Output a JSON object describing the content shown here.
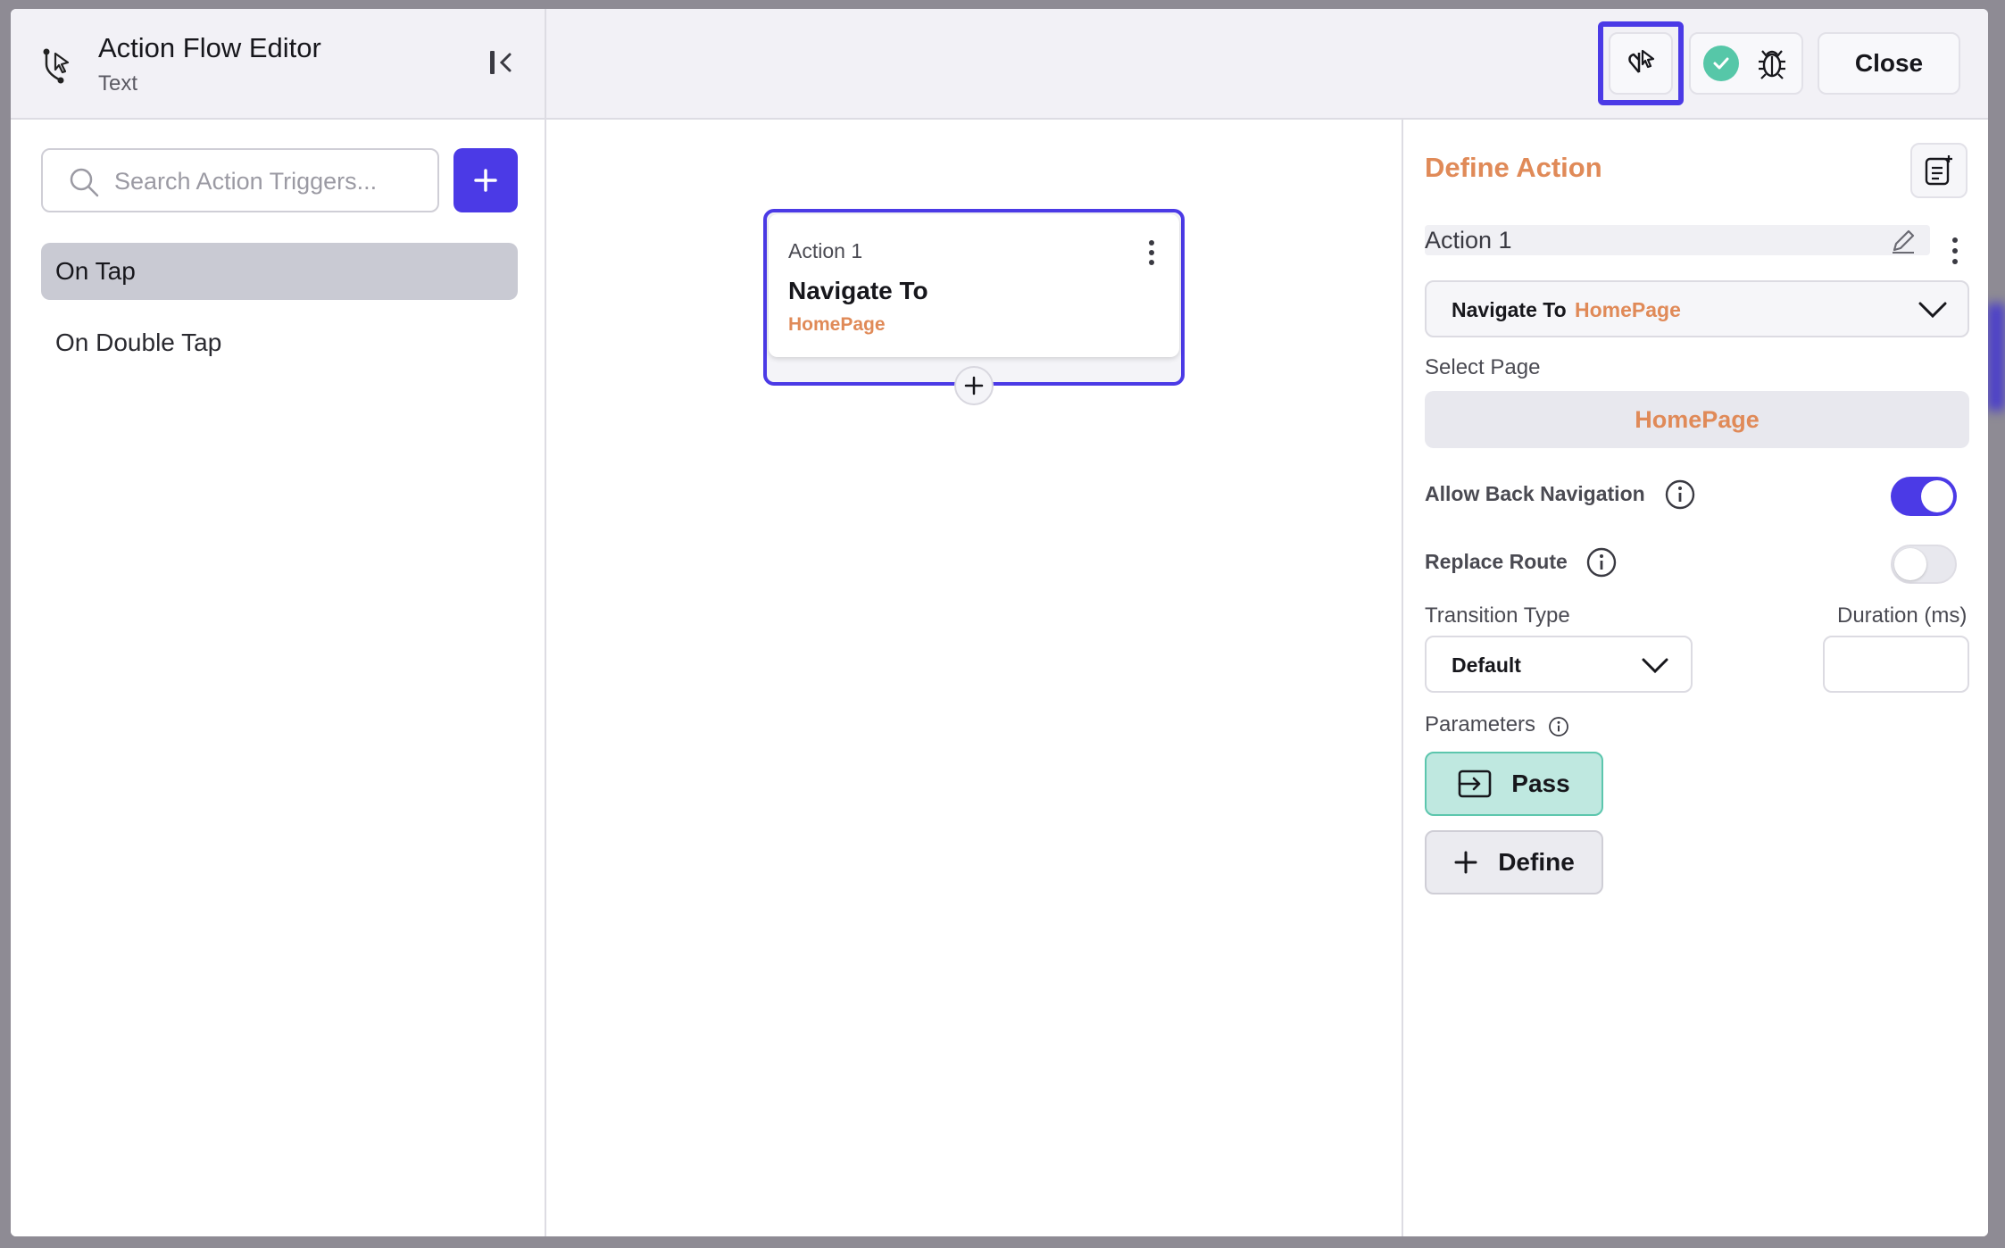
{
  "header": {
    "title": "Action Flow Editor",
    "subtitle": "Text",
    "close_label": "Close",
    "icons": {
      "flow": "action-flow-icon",
      "collapse": "collapse-panel-icon",
      "select": "select-widget-icon",
      "status": "check-icon",
      "debug": "bug-icon"
    }
  },
  "left_panel": {
    "search": {
      "placeholder": "Search Action Triggers...",
      "value": ""
    },
    "triggers": [
      {
        "label": "On Tap",
        "active": true
      },
      {
        "label": "On Double Tap",
        "active": false
      }
    ]
  },
  "canvas": {
    "action_card": {
      "label": "Action 1",
      "title": "Navigate To",
      "target": "HomePage"
    }
  },
  "right_panel": {
    "title": "Define Action",
    "action_name": "Action 1",
    "action_select": {
      "label": "Navigate To",
      "value": "HomePage"
    },
    "select_page_label": "Select Page",
    "selected_page": "HomePage",
    "allow_back_navigation": {
      "label": "Allow Back Navigation",
      "enabled": true
    },
    "replace_route": {
      "label": "Replace Route",
      "enabled": false
    },
    "transition_type": {
      "label": "Transition Type",
      "value": "Default"
    },
    "duration": {
      "label": "Duration (ms)",
      "value": ""
    },
    "parameters_label": "Parameters",
    "pass_label": "Pass",
    "define_label": "Define"
  },
  "colors": {
    "accent": "#4b3ae6",
    "highlight_text": "#e08a58",
    "success": "#56c7a8"
  }
}
